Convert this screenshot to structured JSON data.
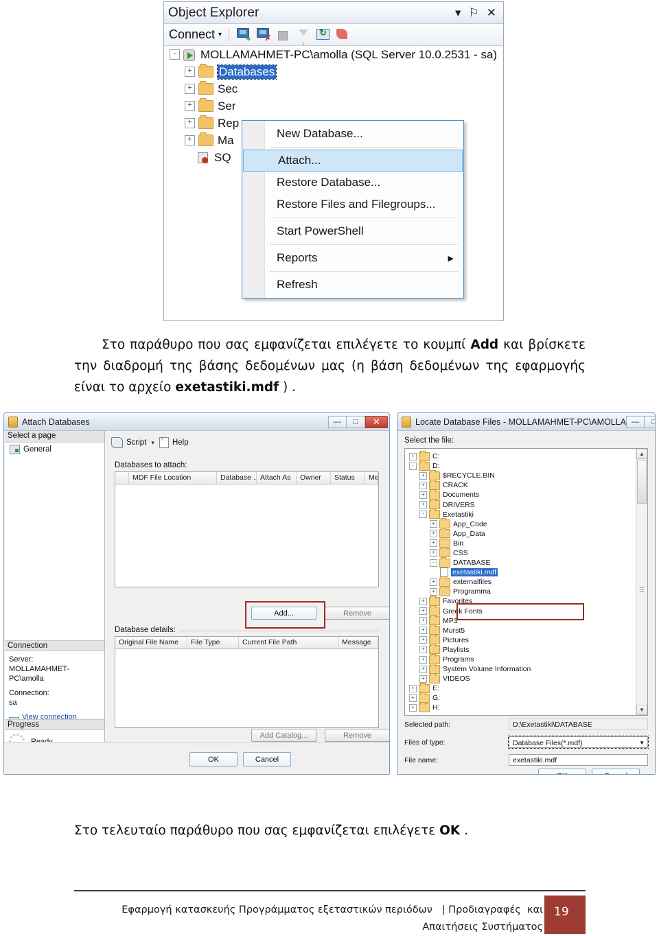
{
  "object_explorer": {
    "title": "Object Explorer",
    "window_controls": [
      "▾",
      "⚐",
      "✕"
    ],
    "toolbar": {
      "connect_label": "Connect",
      "caret": "▾",
      "icons": [
        "connect-server-icon",
        "disconnect-server-icon",
        "stop-icon",
        "filter-icon",
        "refresh-icon",
        "script-icon"
      ]
    },
    "tree": [
      {
        "label": "MOLLAMAHMET-PC\\amolla (SQL Server 10.0.2531 - sa)",
        "level": 0,
        "expander": "-",
        "icon": "server-icon"
      },
      {
        "label": "Databases",
        "level": 1,
        "expander": "+",
        "icon": "folder-icon",
        "selected": true
      },
      {
        "label": "Sec",
        "level": 1,
        "expander": "+",
        "icon": "folder-icon"
      },
      {
        "label": "Ser",
        "level": 1,
        "expander": "+",
        "icon": "folder-icon"
      },
      {
        "label": "Rep",
        "level": 1,
        "expander": "+",
        "icon": "folder-icon"
      },
      {
        "label": "Ma",
        "level": 1,
        "expander": "+",
        "icon": "folder-icon"
      },
      {
        "label": "SQ",
        "level": 1,
        "expander": "",
        "icon": "sql-agent-icon"
      }
    ],
    "context_menu": [
      {
        "label": "New Database...",
        "type": "item"
      },
      {
        "type": "separator"
      },
      {
        "label": "Attach...",
        "type": "item",
        "highlighted": true
      },
      {
        "label": "Restore Database...",
        "type": "item"
      },
      {
        "label": "Restore Files and Filegroups...",
        "type": "item"
      },
      {
        "type": "separator"
      },
      {
        "label": "Start PowerShell",
        "type": "item"
      },
      {
        "type": "separator"
      },
      {
        "label": "Reports",
        "type": "item",
        "submenu_arrow": "▶"
      },
      {
        "type": "separator"
      },
      {
        "label": "Refresh",
        "type": "item"
      }
    ]
  },
  "paragraph_1": {
    "part1": "Στο παράθυρο που σας εμφανίζεται επιλέγετε το κουμπί ",
    "bold1": "Add",
    "part2": " και βρίσκετε την διαδρομή της βάσης δεδομένων μας (η βάση δεδομένων της εφαρμογής είναι το αρχείο ",
    "bold2": "exetastiki.mdf",
    "part3": " ) ."
  },
  "paragraph_2": {
    "part1": "Στο τελευταίο παράθυρο που σας εμφανίζεται επιλέγετε ",
    "bold1": "OK",
    "part2": " ."
  },
  "attach_dialog": {
    "title": "Attach Databases",
    "window_buttons": {
      "minimize": "—",
      "maximize": "□",
      "close": "✕"
    },
    "select_a_page_header": "Select a page",
    "pages": [
      {
        "label": "General"
      }
    ],
    "toolbar": {
      "script_label": "Script",
      "caret": "▾",
      "help_label": "Help"
    },
    "databases_to_attach_label": "Databases to attach:",
    "attach_grid_columns": [
      "MDF File Location",
      "Database ...",
      "Attach As",
      "Owner",
      "Status",
      "Message"
    ],
    "add_button": "Add...",
    "remove_button_1": "Remove",
    "database_details_label": "Database details:",
    "details_grid_columns": [
      "Original File Name",
      "File Type",
      "Current File Path",
      "Message"
    ],
    "add_catalog_button": "Add Catalog...",
    "remove_button_2": "Remove",
    "connection": {
      "header": "Connection",
      "server_label": "Server:",
      "server_value": "MOLLAMAHMET-PC\\amolla",
      "connection_label": "Connection:",
      "connection_value": "sa",
      "link": "View connection properties"
    },
    "progress": {
      "header": "Progress",
      "status": "Ready"
    },
    "ok_button": "OK",
    "cancel_button": "Cancel"
  },
  "locate_dialog": {
    "title": "Locate Database Files - MOLLAMAHMET-PC\\AMOLLA",
    "window_buttons": {
      "minimize": "—",
      "maximize": "□",
      "close": "✕"
    },
    "select_file_label": "Select the file:",
    "tree": [
      {
        "label": "C:",
        "level": 0,
        "expander": "+",
        "icon": "folder-icon"
      },
      {
        "label": "D:",
        "level": 0,
        "expander": "-",
        "icon": "folder-icon"
      },
      {
        "label": "$RECYCLE.BIN",
        "level": 1,
        "expander": "+",
        "icon": "folder-icon"
      },
      {
        "label": "CRACK",
        "level": 1,
        "expander": "+",
        "icon": "folder-icon"
      },
      {
        "label": "Documents",
        "level": 1,
        "expander": "+",
        "icon": "folder-icon"
      },
      {
        "label": "DRIVERS",
        "level": 1,
        "expander": "+",
        "icon": "folder-icon"
      },
      {
        "label": "Exetastiki",
        "level": 1,
        "expander": "-",
        "icon": "folder-icon"
      },
      {
        "label": "App_Code",
        "level": 2,
        "expander": "+",
        "icon": "folder-icon"
      },
      {
        "label": "App_Data",
        "level": 2,
        "expander": "+",
        "icon": "folder-icon"
      },
      {
        "label": "Bin",
        "level": 2,
        "expander": "+",
        "icon": "folder-icon"
      },
      {
        "label": "CSS",
        "level": 2,
        "expander": "+",
        "icon": "folder-icon"
      },
      {
        "label": "DATABASE",
        "level": 2,
        "expander": "-",
        "icon": "folder-icon"
      },
      {
        "label": "exetastiki.mdf",
        "level": 3,
        "expander": "",
        "icon": "file-icon",
        "selected": true
      },
      {
        "label": "externalfiles",
        "level": 2,
        "expander": "+",
        "icon": "folder-icon"
      },
      {
        "label": "Programma",
        "level": 2,
        "expander": "+",
        "icon": "folder-icon"
      },
      {
        "label": "Favorites",
        "level": 1,
        "expander": "+",
        "icon": "folder-icon"
      },
      {
        "label": "Greek Fonts",
        "level": 1,
        "expander": "+",
        "icon": "folder-icon"
      },
      {
        "label": "MP3",
        "level": 1,
        "expander": "+",
        "icon": "folder-icon"
      },
      {
        "label": "Murst5",
        "level": 1,
        "expander": "+",
        "icon": "folder-icon"
      },
      {
        "label": "Pictures",
        "level": 1,
        "expander": "+",
        "icon": "folder-icon"
      },
      {
        "label": "Playlists",
        "level": 1,
        "expander": "+",
        "icon": "folder-icon"
      },
      {
        "label": "Programs",
        "level": 1,
        "expander": "+",
        "icon": "folder-icon"
      },
      {
        "label": "System Volume Information",
        "level": 1,
        "expander": "+",
        "icon": "folder-icon"
      },
      {
        "label": "VIDEOS",
        "level": 1,
        "expander": "+",
        "icon": "folder-icon"
      },
      {
        "label": "E:",
        "level": 0,
        "expander": "+",
        "icon": "folder-icon"
      },
      {
        "label": "G:",
        "level": 0,
        "expander": "+",
        "icon": "folder-icon"
      },
      {
        "label": "H:",
        "level": 0,
        "expander": "+",
        "icon": "folder-icon"
      }
    ],
    "selected_path_label": "Selected path:",
    "selected_path_value": "D:\\Exetastiki\\DATABASE",
    "files_of_type_label": "Files of type:",
    "files_of_type_value": "Database Files(*.mdf)",
    "file_name_label": "File name:",
    "file_name_value": "exetastiki.mdf",
    "ok_button": "OK",
    "cancel_button": "Cancel"
  },
  "footer": {
    "line1": "Εφαρμογή κατασκευής Προγράμματος εξεταστικών περιόδων   | Προδιαγραφές  και",
    "line2": "Απαιτήσεις Συστήματος",
    "page_number": "19",
    "accent_color": "#9e3b33"
  }
}
